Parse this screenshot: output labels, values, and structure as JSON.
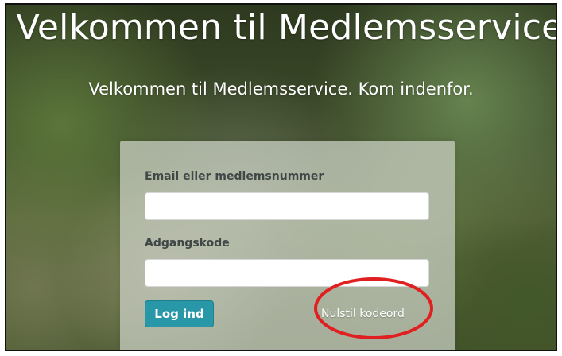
{
  "page": {
    "title": "Velkommen til Medlemsservice",
    "subtitle": "Velkommen til Medlemsservice. Kom indenfor."
  },
  "login_form": {
    "email_label": "Email eller medlemsnummer",
    "email_value": "",
    "password_label": "Adgangskode",
    "password_value": "",
    "login_button": "Log ind",
    "reset_link": "Nulstil kodeord"
  },
  "colors": {
    "primary_button": "#2897a8",
    "annotation": "#e02020"
  }
}
